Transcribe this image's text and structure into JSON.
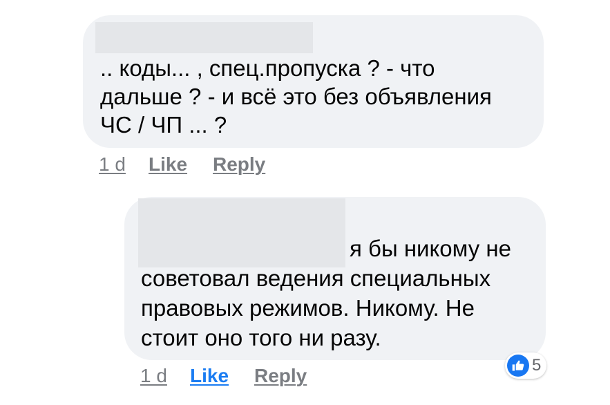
{
  "comments": [
    {
      "lines": [
        ".. коды... , спец.пропуска ? - что",
        "дальше ? - и всё это без объявления",
        "ЧС / ЧП ... ?"
      ],
      "time": "1 d",
      "like_label": "Like",
      "reply_label": "Reply"
    },
    {
      "lines": [
        "я бы никому не",
        "советовал ведения специальных",
        "правовых режимов. Никому. Не",
        "стоит оно того ни разу."
      ],
      "time": "1 d",
      "like_label": "Like",
      "reply_label": "Reply",
      "liked": true,
      "reaction_count": "5",
      "reaction_icon": "thumbs-up-icon"
    }
  ],
  "colors": {
    "bubble": "#f0f2f5",
    "redaction": "#e4e6e9",
    "like_active": "#1a7cf2",
    "meta_gray": "#7a7d82",
    "reaction_blue": "#1877f2"
  }
}
